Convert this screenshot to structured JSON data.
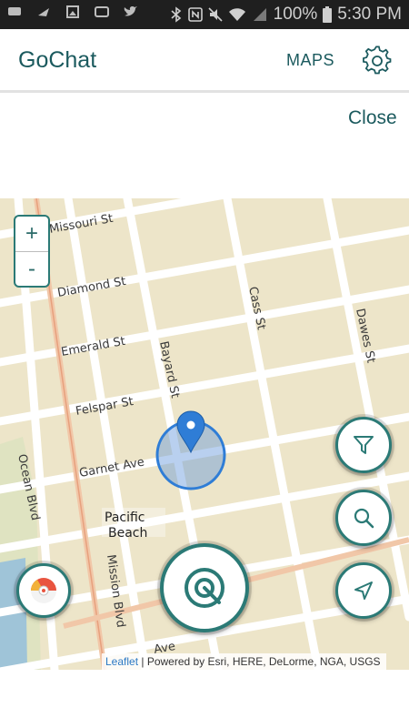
{
  "status_bar": {
    "battery": "100%",
    "time": "5:30 PM"
  },
  "app_bar": {
    "title": "GoChat",
    "maps_label": "MAPS"
  },
  "close_label": "Close",
  "map": {
    "zoom_in_label": "+",
    "zoom_out_label": "-",
    "street_labels": {
      "missouri": "Missouri St",
      "diamond": "Diamond St",
      "emerald": "Emerald St",
      "felspar": "Felspar St",
      "garnet": "Garnet Ave",
      "bayard": "Bayard St",
      "cass": "Cass St",
      "dawes": "Dawes St",
      "ocean": "Ocean Blvd",
      "mission": "Mission Blvd",
      "ave_bottom": "Ave"
    },
    "place_label_line1": "Pacific",
    "place_label_line2": "Beach",
    "attribution_link": "Leaflet",
    "attribution_text": " | Powered by Esri, HERE, DeLorme, NGA, USGS"
  },
  "colors": {
    "accent": "#1b5a5e",
    "map_land": "#ece4c8",
    "marker": "#2f7dd6"
  }
}
